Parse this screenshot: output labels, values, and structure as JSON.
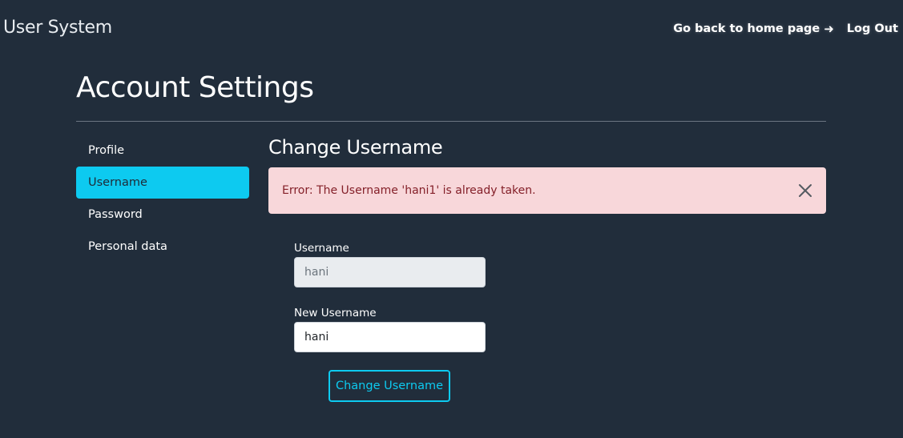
{
  "app": {
    "brand": "User System"
  },
  "nav": {
    "home_link": "Go back to home page",
    "home_arrow": "➜",
    "logout": "Log Out"
  },
  "page": {
    "title": "Account Settings"
  },
  "sidebar": {
    "items": [
      {
        "label": "Profile",
        "active": false
      },
      {
        "label": "Username",
        "active": true
      },
      {
        "label": "Password",
        "active": false
      },
      {
        "label": "Personal data",
        "active": false
      }
    ]
  },
  "section": {
    "title": "Change Username"
  },
  "alert": {
    "message": "Error: The Username 'hani1' is already taken.",
    "close_icon": "close-icon"
  },
  "form": {
    "username_label": "Username",
    "username_value": "hani",
    "new_username_label": "New Username",
    "new_username_value": "hani",
    "submit_label": "Change Username"
  },
  "colors": {
    "background": "#212d3b",
    "accent": "#0dcaf0",
    "alert_bg": "#f8d7da",
    "alert_text": "#842029"
  }
}
